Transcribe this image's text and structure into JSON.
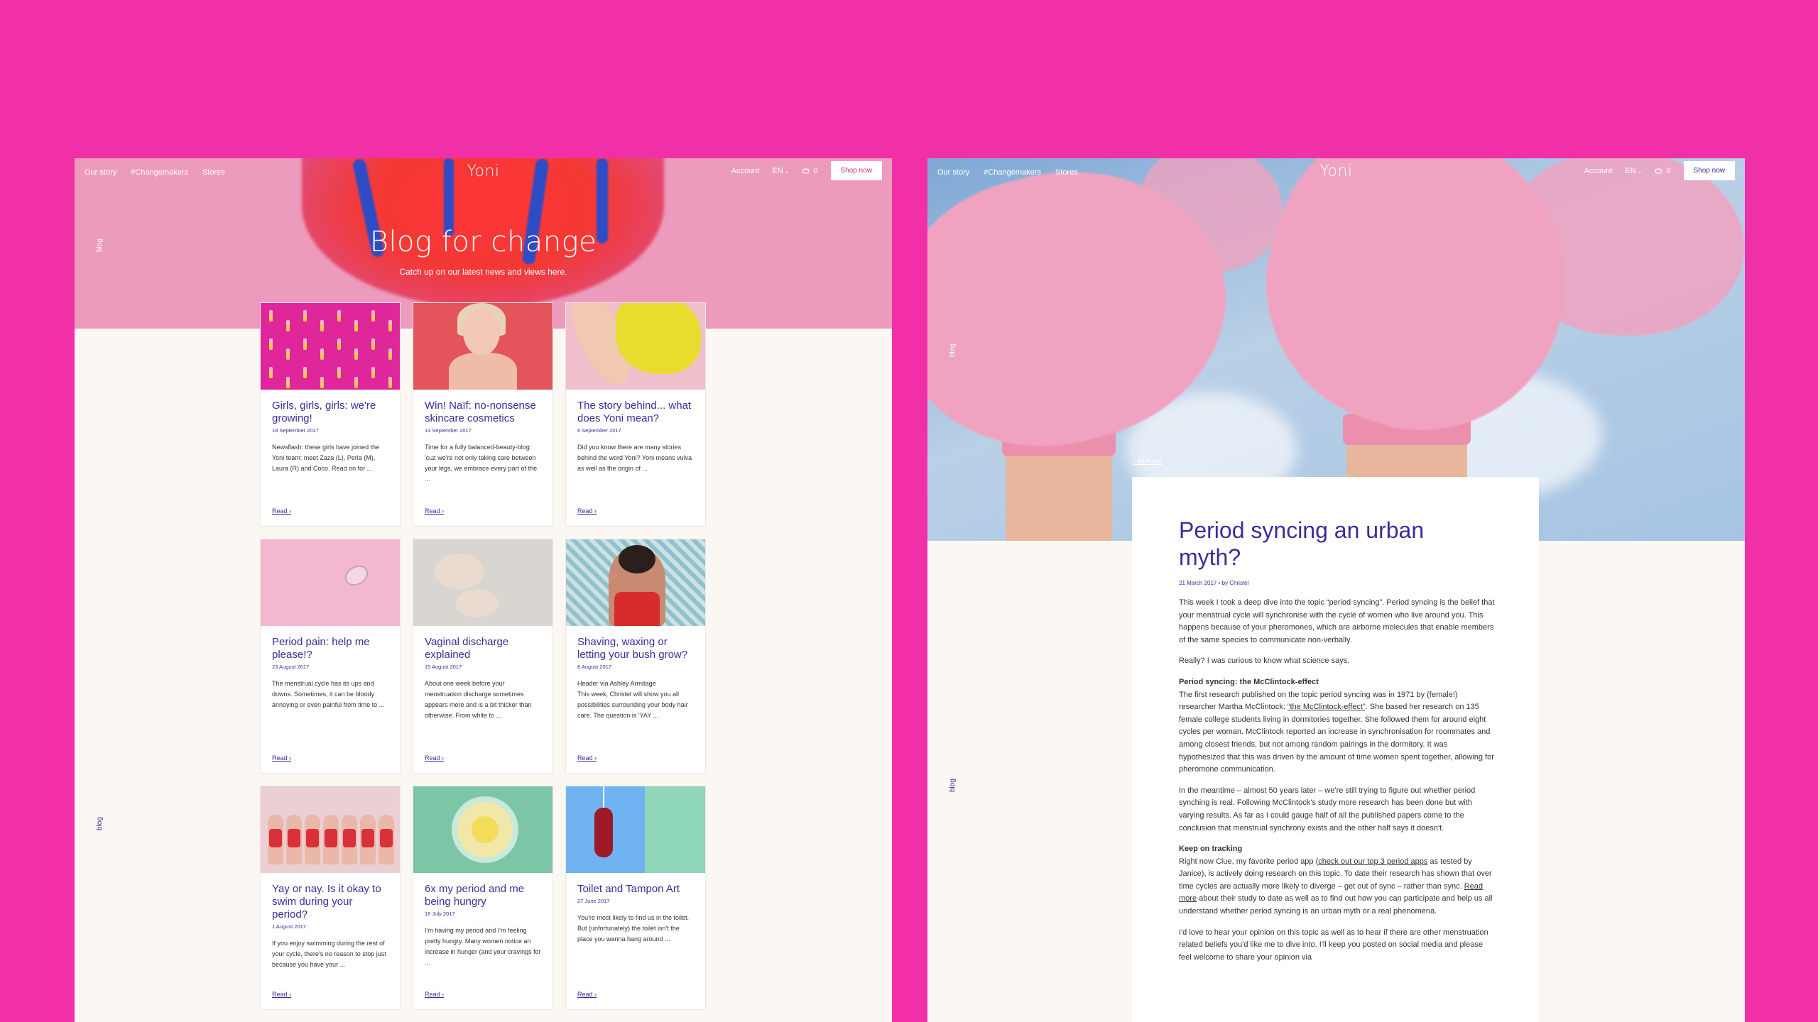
{
  "nav": {
    "links": [
      "Our story",
      "#Changemakers",
      "Stores"
    ],
    "logo": "Yoni",
    "account": "Account",
    "language": "EN",
    "cart_count": "0",
    "shop_label": "Shop now"
  },
  "blog_label": "blog",
  "listing": {
    "title": "Blog for change",
    "subtitle": "Catch up on our latest news and views here.",
    "posts": [
      {
        "title": "Girls, girls, girls: we're growing!",
        "date": "18 September 2017",
        "excerpt": "Newsflash: these girls have joined the Yoni team: meet Zaza (L), Perla (M), Laura (R) and Coco. Read on for ...",
        "read": "Read ›"
      },
      {
        "title": "Win! Naïf: no-nonsense skincare cosmetics",
        "date": "13 September 2017",
        "excerpt": "Time for a fully balanced-beauty-blog: 'cuz we're not only taking care between your legs, we embrace every part of the ...",
        "read": "Read ›"
      },
      {
        "title": "The story behind... what does Yoni mean?",
        "date": "6 September 2017",
        "excerpt": "Did you know there are many stories behind the word Yoni? Yoni means vulva as well as the origin of ...",
        "read": "Read ›"
      },
      {
        "title": "Period pain: help me please!?",
        "date": "23 August 2017",
        "excerpt": "The menstrual cycle has its ups and downs. Sometimes, it can be bloody annoying or even painful from time to ...",
        "read": "Read ›"
      },
      {
        "title": "Vaginal discharge explained",
        "date": "15 August 2017",
        "excerpt": "About one week before your menstruation discharge sometimes appears more and is a bit thicker than otherwise. From white to ...",
        "read": "Read ›"
      },
      {
        "title": "Shaving, waxing or letting your bush grow?",
        "date": "8 August 2017",
        "excerpt": "Header via Ashley Armitage\nThis week, Christel will show you all possibilities surrounding your body hair care. The question is 'YAY ...",
        "read": "Read ›"
      },
      {
        "title": "Yay or nay. Is it okay to swim during your period?",
        "date": "1 August 2017",
        "excerpt": "If you enjoy swimming during the rest of your cycle, there's no reason to stop just because you have your ...",
        "read": "Read ›"
      },
      {
        "title": "6x my period and me being hungry",
        "date": "18 July 2017",
        "excerpt": "I'm having my period and I'm feeling pretty hungry. Many women notice an increase in hunger (and your cravings for ...",
        "read": "Read ›"
      },
      {
        "title": "Toilet and Tampon Art",
        "date": "27 June 2017",
        "excerpt": "You're most likely to find us in the toilet. But (unfortunately) the toilet isn't the place you wanna hang around ...",
        "read": "Read ›"
      }
    ]
  },
  "article": {
    "back": "‹ All Posts",
    "title": "Period syncing an urban myth?",
    "meta": "21 March 2017 • by Christel",
    "p1": "This week I took a deep dive into the topic “period syncing”. Period syncing is the belief that your menstrual cycle will synchronise with the cycle of women who live around you. This happens because of your pheromones, which are airborne molecules that enable members of the same species to communicate non-verbally.",
    "p2": "Really? I was curious to know what science says.",
    "h1": "Period syncing: the McClintock-effect",
    "p3a": "The first research published on the topic period syncing was in 1971 by (female!) researcher Martha McClintock: ",
    "p3link": "“the McClintock-effect”",
    "p3b": ". She based her research on 135 female college students living in dormitories together. She followed them for around eight cycles per woman. McClintock reported an increase in synchronisation for roommates and among closest friends, but not among random pairings in the dormitory. It was hypothesized that this was driven by the amount of time women spent together, allowing for pheromone communication.",
    "p4": "In the meantime – almost 50 years later – we're still trying to figure out whether period synching is real. Following McClintock's study more research has been done but with varying results. As far as I could gauge half of all the published papers come to the conclusion that menstrual synchrony exists and the other half says it doesn't.",
    "h2": "Keep on tracking",
    "p5a": "Right now Clue, my favorite period app (",
    "p5link1": "check out our top 3 period apps",
    "p5b": " as tested by Janice), is actively doing research on this topic. To date their research has shown that over time cycles are actually more likely to diverge – get out of sync – rather than sync. ",
    "p5link2": "Read more",
    "p5c": " about their study to date as well as to find out how you can participate and help us all understand whether period syncing is an urban myth or a real phenomena.",
    "p6": "I'd love to hear your opinion on this topic as well as to hear if there are other menstruation related beliefs you'd like me to dive into. I'll keep you posted on social media and please feel welcome to share your opinion via"
  }
}
